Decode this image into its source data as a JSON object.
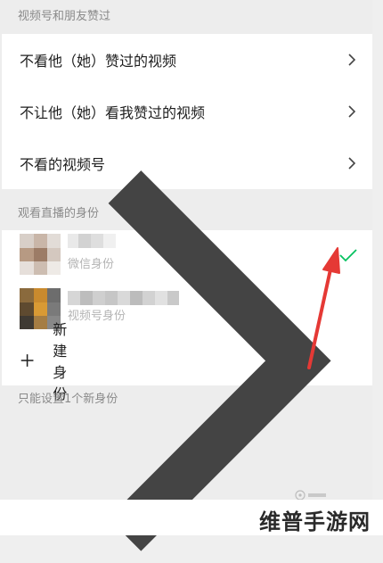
{
  "sections": {
    "likes_title": "视频号和朋友赞过",
    "identity_title": "观看直播的身份",
    "footer_note": "只能设置1个新身份"
  },
  "likes_rows": [
    {
      "label": "不看他（她）赞过的视频",
      "icon": "chevron-right-icon"
    },
    {
      "label": "不让他（她）看我赞过的视频",
      "icon": "chevron-right-icon"
    },
    {
      "label": "不看的视频号",
      "icon": "chevron-right-icon"
    }
  ],
  "identities": [
    {
      "sub_label": "微信身份",
      "selected": true
    },
    {
      "sub_label": "视频号身份",
      "selected": false
    }
  ],
  "new_identity": {
    "label": "新建身份",
    "icon": "plus-icon"
  },
  "watermark": "维普手游网",
  "colors": {
    "background": "#ededed",
    "card": "#ffffff",
    "check_green": "#07c160",
    "annotation_red": "#e53935",
    "muted_text": "#8a8a8a"
  }
}
